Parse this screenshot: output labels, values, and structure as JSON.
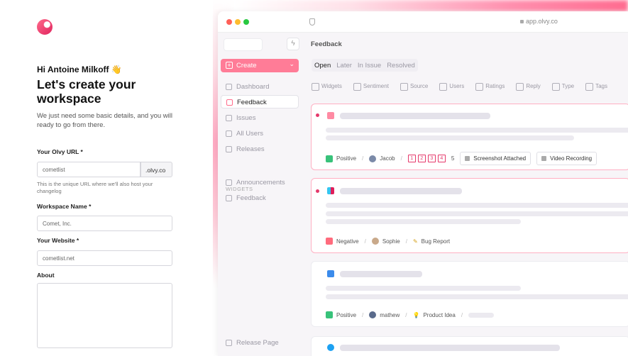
{
  "form": {
    "greeting": "Hi Antoine Milkoff 👋",
    "title": "Let's create your workspace",
    "description": "We just need some basic details, and you will ready to go from there.",
    "url_label": "Your Olvy URL *",
    "url_value": "cometlist",
    "url_suffix": ".olvy.co",
    "url_hint": "This is the unique URL where we'll also host your changelog",
    "workspace_label": "Workspace Name *",
    "workspace_placeholder": "Comet, Inc.",
    "website_label": "Your Website *",
    "website_value": "cometlist.net",
    "about_label": "About",
    "about_value": ""
  },
  "browser": {
    "address": "app.olvy.co",
    "dot_colors": [
      "#ff5f57",
      "#febc2e",
      "#28c840"
    ]
  },
  "sidebar": {
    "create_label": "Create",
    "items": [
      {
        "label": "Dashboard",
        "icon": "home-icon"
      },
      {
        "label": "Feedback",
        "icon": "feedback-icon",
        "active": true
      },
      {
        "label": "Issues",
        "icon": "issues-icon"
      },
      {
        "label": "All Users",
        "icon": "users-icon"
      },
      {
        "label": "Releases",
        "icon": "releases-icon"
      }
    ],
    "widgets_heading": "WIDGETS",
    "widget_items": [
      {
        "label": "Announcements",
        "icon": "announcements-icon"
      },
      {
        "label": "Feedback",
        "icon": "feedback-widget-icon"
      }
    ],
    "release_page_label": "Release Page"
  },
  "main": {
    "heading": "Feedback",
    "tabs": [
      "Open",
      "Later",
      "In Issue",
      "Resolved"
    ],
    "active_tab": "Open",
    "filters": [
      "Widgets",
      "Sentiment",
      "Source",
      "Users",
      "Ratings",
      "Reply",
      "Type",
      "Tags"
    ],
    "cards": [
      {
        "sentiment": "Positive",
        "user": "Jacob",
        "ratings": [
          "1",
          "2",
          "3",
          "4"
        ],
        "rating_value": "5",
        "attachments": [
          "Screenshot Attached",
          "Video Recording"
        ]
      },
      {
        "sentiment": "Negative",
        "user": "Sophie",
        "type": "Bug Report"
      },
      {
        "sentiment": "Positive",
        "user": "mathew",
        "type": "Product Idea"
      }
    ]
  },
  "colors": {
    "accent": "#ff7c97",
    "positive": "#38c27a",
    "negative": "#ff6b7d"
  }
}
